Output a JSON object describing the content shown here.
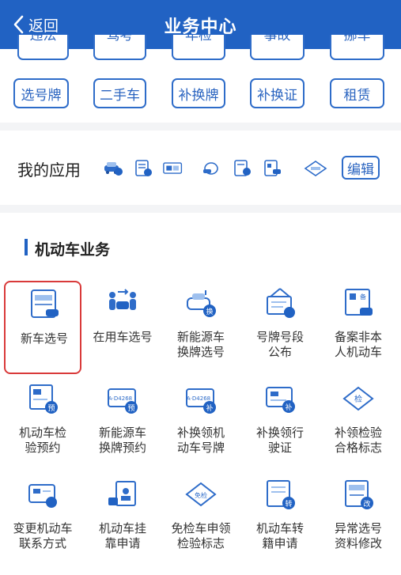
{
  "header": {
    "back_label": "返回",
    "title": "业务中心"
  },
  "categories": {
    "row1": [
      "违法",
      "驾考",
      "年检",
      "事故",
      "挪车"
    ],
    "row2": [
      "选号牌",
      "二手车",
      "补换牌",
      "补换证",
      "租赁"
    ]
  },
  "my_apps": {
    "label": "我的应用",
    "edit_label": "编辑"
  },
  "section": {
    "title": "机动车业务"
  },
  "services": [
    {
      "label": "新车选号",
      "selected": true
    },
    {
      "label": "在用车选号"
    },
    {
      "label": "新能源车\n换牌选号",
      "badge": "换"
    },
    {
      "label": "号牌号段\n公布"
    },
    {
      "label": "备案非本\n人机动车",
      "badge": "备"
    },
    {
      "label": "机动车检\n验预约",
      "badge": "预"
    },
    {
      "label": "新能源车\n换牌预约",
      "badge": "预"
    },
    {
      "label": "补换领机\n动车号牌",
      "badge": "补"
    },
    {
      "label": "补换领行\n驶证",
      "badge": "补"
    },
    {
      "label": "补领检验\n合格标志",
      "badge": "检"
    },
    {
      "label": "变更机动车\n联系方式"
    },
    {
      "label": "机动车挂\n靠申请"
    },
    {
      "label": "免检车申领\n检验标志",
      "badge": "免检"
    },
    {
      "label": "机动车转\n籍申请",
      "badge": "转"
    },
    {
      "label": "异常选号\n资料修改",
      "badge": "改"
    }
  ],
  "colors": {
    "primary": "#2162c3",
    "accent": "#2e6cc9",
    "selected_border": "#d93a3a",
    "divider": "#f3f4f6"
  }
}
